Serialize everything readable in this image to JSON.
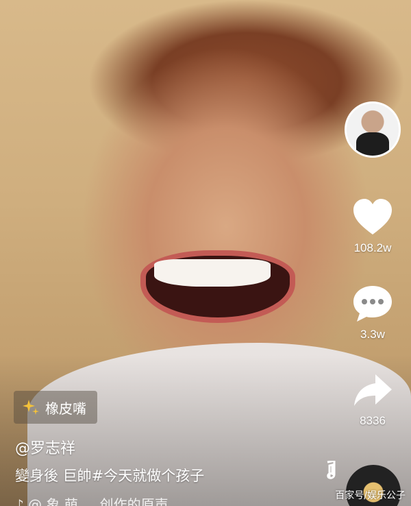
{
  "tag": {
    "label": "橡皮嘴"
  },
  "author": {
    "handle": "@罗志祥"
  },
  "caption": {
    "text": "變身後 巨帥#今天就做个孩子"
  },
  "music": {
    "text": "♪ @ 象 萌 ... 创作的原声"
  },
  "actions": {
    "likes": "108.2w",
    "comments": "3.3w",
    "shares": "8336"
  },
  "watermark": "百家号/娱乐公子",
  "icons": {
    "tag": "sparkle-icon",
    "like": "heart-icon",
    "comment": "comment-bubble-icon",
    "share": "share-arrow-icon",
    "music": "music-note-icon"
  }
}
